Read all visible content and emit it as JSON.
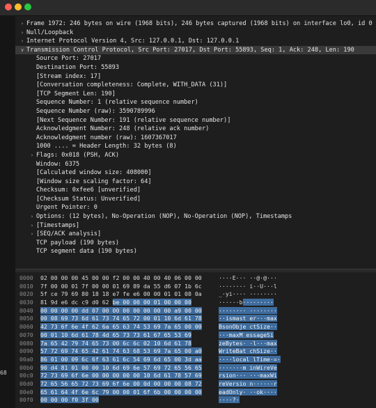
{
  "window": {
    "colors": {
      "selection": "#3e6c9e",
      "row_highlight": "#3a3a3a",
      "background": "#1e1e1e"
    }
  },
  "detail_rows": [
    {
      "indent": 0,
      "arrow": "right",
      "text": "Frame 1972: 246 bytes on wire (1968 bits), 246 bytes captured (1968 bits) on interface lo0, id 0"
    },
    {
      "indent": 0,
      "arrow": "right",
      "text": "Null/Loopback"
    },
    {
      "indent": 0,
      "arrow": "right",
      "text": "Internet Protocol Version 4, Src: 127.0.0.1, Dst: 127.0.0.1"
    },
    {
      "indent": 0,
      "arrow": "down",
      "text": "Transmission Control Protocol, Src Port: 27017, Dst Port: 55893, Seq: 1, Ack: 248, Len: 190",
      "highlight": true
    },
    {
      "indent": 1,
      "text": "Source Port: 27017"
    },
    {
      "indent": 1,
      "text": "Destination Port: 55893"
    },
    {
      "indent": 1,
      "text": "[Stream index: 17]"
    },
    {
      "indent": 1,
      "text": "[Conversation completeness: Complete, WITH_DATA (31)]"
    },
    {
      "indent": 1,
      "text": "[TCP Segment Len: 190]"
    },
    {
      "indent": 1,
      "text": "Sequence Number: 1    (relative sequence number)"
    },
    {
      "indent": 1,
      "text": "Sequence Number (raw): 3590789996"
    },
    {
      "indent": 1,
      "text": "[Next Sequence Number: 191    (relative sequence number)]"
    },
    {
      "indent": 1,
      "text": "Acknowledgment Number: 248    (relative ack number)"
    },
    {
      "indent": 1,
      "text": "Acknowledgment number (raw): 1607367017"
    },
    {
      "indent": 1,
      "text": "1000 .... = Header Length: 32 bytes (8)"
    },
    {
      "indent": 1,
      "arrow": "right",
      "text": "Flags: 0x018 (PSH, ACK)"
    },
    {
      "indent": 1,
      "text": "Window: 6375"
    },
    {
      "indent": 1,
      "text": "[Calculated window size: 408000]"
    },
    {
      "indent": 1,
      "text": "[Window size scaling factor: 64]"
    },
    {
      "indent": 1,
      "text": "Checksum: 0xfee6 [unverified]"
    },
    {
      "indent": 1,
      "text": "[Checksum Status: Unverified]"
    },
    {
      "indent": 1,
      "text": "Urgent Pointer: 0"
    },
    {
      "indent": 1,
      "arrow": "right",
      "text": "Options: (12 bytes), No-Operation (NOP), No-Operation (NOP), Timestamps"
    },
    {
      "indent": 1,
      "arrow": "right",
      "text": "[Timestamps]"
    },
    {
      "indent": 1,
      "arrow": "right",
      "text": "[SEQ/ACK analysis]"
    },
    {
      "indent": 1,
      "text": "TCP payload (190 bytes)"
    },
    {
      "indent": 1,
      "text": "TCP segment data (190 bytes)"
    }
  ],
  "hex_rows": [
    {
      "offset": "0000",
      "bytes_plain": "02 00 00 00 45 00 00 f2  00 00 40 00 40 06 00 00",
      "bytes_sel": "",
      "ascii_plain": "····E··· ··@·@···",
      "ascii_sel": ""
    },
    {
      "offset": "0010",
      "bytes_plain": "7f 00 00 01 7f 00 00 01  69 89 da 55 d6 07 1b 6c",
      "bytes_sel": "",
      "ascii_plain": "········ i··U···l",
      "ascii_sel": ""
    },
    {
      "offset": "0020",
      "bytes_plain": "5f ce 79 69 80 18 18 e7  fe e6 00 00 01 01 08 0a",
      "bytes_sel": "",
      "ascii_plain": "_·yi···· ········",
      "ascii_sel": ""
    },
    {
      "offset": "0030",
      "bytes_plain": "81 9d e6 dc c9 d0 62 ",
      "bytes_sel": "be 00 00 00 01 00 00 00",
      "ascii_plain": "······b",
      "ascii_sel": "·········"
    },
    {
      "offset": "0040",
      "bytes_plain": "",
      "bytes_sel": "00 00 00 00 dd 07 00 00  00 00 00 00 00 a9 00 00",
      "ascii_plain": "",
      "ascii_sel": "········ ········"
    },
    {
      "offset": "0050",
      "bytes_plain": "",
      "bytes_sel": "00 08 69 73 6d 61 73 74  65 72 00 01 10 6d 61 78",
      "ascii_plain": "",
      "ascii_sel": "··ismast er···max"
    },
    {
      "offset": "0060",
      "bytes_plain": "",
      "bytes_sel": "42 73 6f 6e 4f 62 6a 65  63 74 53 69 7a 65 00 00",
      "ascii_plain": "",
      "ascii_sel": "BsonObje ctSize··"
    },
    {
      "offset": "0070",
      "bytes_plain": "",
      "bytes_sel": "00 01 10 6d 61 78 4d 65  73 73 61 67 65 53 69",
      "ascii_plain": "",
      "ascii_sel": "···maxM essageSi"
    },
    {
      "offset": "0080",
      "bytes_plain": "",
      "bytes_sel": "7a 65 42 79 74 65 73 00  6c 6c 02 10 6d 61 78",
      "ascii_plain": "",
      "ascii_sel": "zeBytes· ·l···max"
    },
    {
      "offset": "0090",
      "bytes_plain": "",
      "bytes_sel": "57 72 69 74 65 42 61 74  63 68 53 69 7a 65 00 a0",
      "ascii_plain": "",
      "ascii_sel": "WriteBat chSize··"
    },
    {
      "offset": "00a0",
      "bytes_plain": "",
      "bytes_sel": "86 01 00 09 6c 6f 63 61  6c 54 69 6d 65 00 3d aa",
      "ascii_plain": "",
      "ascii_sel": "····local lTime·=·"
    },
    {
      "offset": "00b0",
      "bytes_plain": "",
      "bytes_sel": "90 d4 81 01 00 00 10 6d  69 6e 57 69 72 65 56 65",
      "ascii_plain": "",
      "ascii_sel": "·······m inWireVe"
    },
    {
      "offset": "00c0",
      "bytes_plain": "",
      "bytes_sel": "72 73 69 6f 6e 00 00 00  00 00 10 6d 61 78 57 69",
      "ascii_plain": "",
      "ascii_sel": "rsion··· ···maxWi"
    },
    {
      "offset": "00d0",
      "bytes_plain": "",
      "bytes_sel": "72 65 56 65 72 73 69 6f  6e 00 0d 00 00 00 08 72",
      "ascii_plain": "",
      "ascii_sel": "reVersio n······r"
    },
    {
      "offset": "00e0",
      "bytes_plain": "",
      "bytes_sel": "65 61 64 4f 6e 6c 79 00  00 01 6f 6b 00 00 00 00",
      "ascii_plain": "",
      "ascii_sel": "eadOnly· ··ok····"
    },
    {
      "offset": "00f0",
      "bytes_plain": "",
      "bytes_sel": "00 00 00 f0 3f 00",
      "ascii_plain": "",
      "ascii_sel": "····?·"
    }
  ],
  "side_label": "68"
}
